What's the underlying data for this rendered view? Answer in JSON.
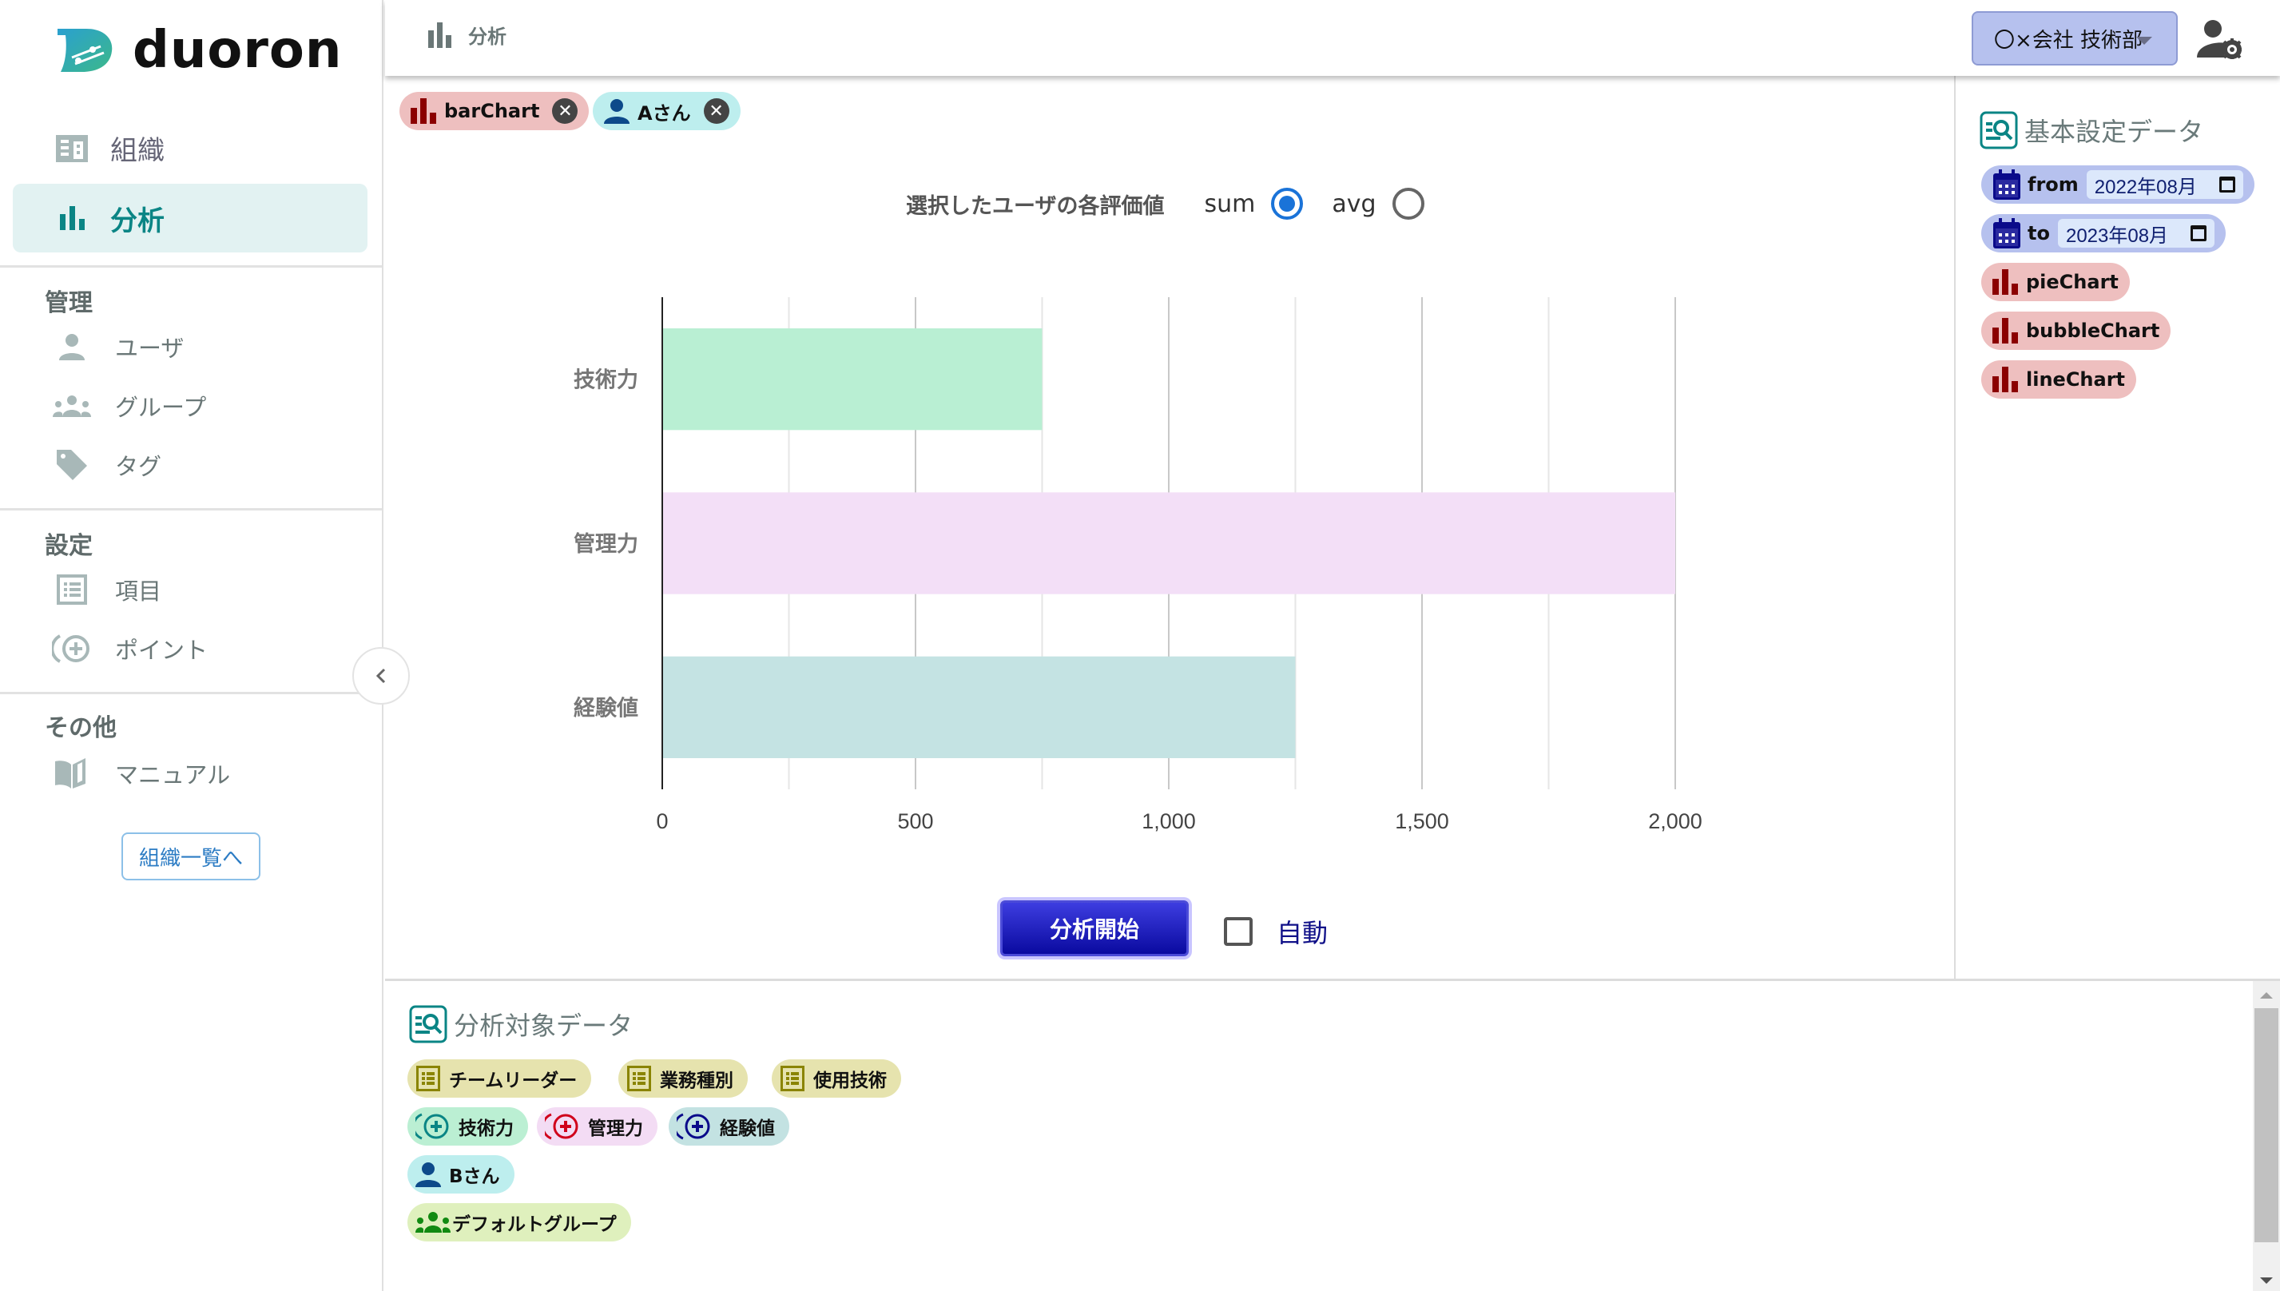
{
  "app": {
    "brand": "duoron"
  },
  "sidebar": {
    "nav": [
      {
        "label": "組織",
        "icon": "building-icon",
        "active": false
      },
      {
        "label": "分析",
        "icon": "bar-chart-icon",
        "active": true
      }
    ],
    "sections": [
      {
        "title": "管理",
        "items": [
          {
            "label": "ユーザ",
            "icon": "user-icon"
          },
          {
            "label": "グループ",
            "icon": "group-icon"
          },
          {
            "label": "タグ",
            "icon": "tag-icon"
          }
        ]
      },
      {
        "title": "設定",
        "items": [
          {
            "label": "項目",
            "icon": "list-icon"
          },
          {
            "label": "ポイント",
            "icon": "point-icon"
          }
        ]
      },
      {
        "title": "その他",
        "items": [
          {
            "label": "マニュアル",
            "icon": "book-icon"
          }
        ]
      }
    ],
    "org_list_button": "組織一覧へ"
  },
  "header": {
    "title": "分析",
    "org_select": "〇×会社 技術部"
  },
  "main": {
    "selected_chips": [
      {
        "label": "barChart",
        "type": "chart"
      },
      {
        "label": "Aさん",
        "type": "user"
      }
    ],
    "aggregation": {
      "title": "選択したユーザの各評価値",
      "options": [
        {
          "label": "sum",
          "selected": true
        },
        {
          "label": "avg",
          "selected": false
        }
      ]
    },
    "run_button": "分析開始",
    "auto_label": "自動",
    "auto_checked": false
  },
  "chart_data": {
    "type": "bar",
    "orientation": "horizontal",
    "title": "",
    "xlabel": "",
    "ylabel": "",
    "categories": [
      "技術力",
      "管理力",
      "経験値"
    ],
    "values": [
      750,
      2000,
      1250
    ],
    "colors": [
      "#b9efd3",
      "#f3dff7",
      "#c4e3e3"
    ],
    "xlim": [
      0,
      2000
    ],
    "xticks": [
      0,
      500,
      1000,
      1500,
      2000
    ],
    "xtick_labels": [
      "0",
      "500",
      "1,000",
      "1,500",
      "2,000"
    ],
    "grid": true,
    "legend": "none"
  },
  "right_panel": {
    "title": "基本設定データ",
    "from_label": "from",
    "from_value": "2022年08月",
    "to_label": "to",
    "to_value": "2023年08月",
    "charts": [
      "pieChart",
      "bubbleChart",
      "lineChart"
    ]
  },
  "bottom_panel": {
    "title": "分析対象データ",
    "items": [
      {
        "label": "チームリーダー",
        "type": "item"
      },
      {
        "label": "業務種別",
        "type": "item"
      },
      {
        "label": "使用技術",
        "type": "item"
      }
    ],
    "points": [
      {
        "label": "技術力",
        "color": "#0a8585"
      },
      {
        "label": "管理力",
        "color": "#d0021b"
      },
      {
        "label": "経験値",
        "color": "#0a0a8a"
      }
    ],
    "users": [
      {
        "label": "Bさん"
      }
    ],
    "groups": [
      {
        "label": "デフォルトグループ"
      }
    ]
  }
}
